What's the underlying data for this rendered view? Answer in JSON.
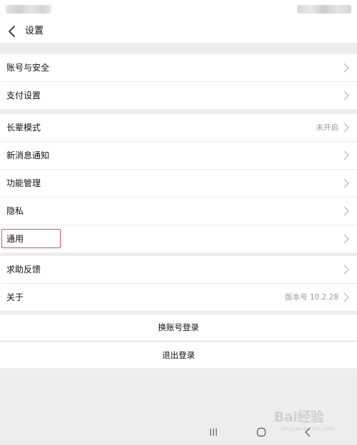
{
  "header": {
    "title": "设置"
  },
  "groups": [
    {
      "items": [
        {
          "label": "账号与安全",
          "value": ""
        },
        {
          "label": "支付设置",
          "value": ""
        }
      ]
    },
    {
      "items": [
        {
          "label": "长辈模式",
          "value": "未开启"
        },
        {
          "label": "新消息通知",
          "value": ""
        },
        {
          "label": "功能管理",
          "value": ""
        },
        {
          "label": "隐私",
          "value": ""
        },
        {
          "label": "通用",
          "value": ""
        }
      ]
    },
    {
      "items": [
        {
          "label": "求助反馈",
          "value": ""
        },
        {
          "label": "关于",
          "value": "版本号 10.2.28"
        }
      ]
    }
  ],
  "actions": {
    "switch_account": "换账号登录",
    "logout": "退出登录"
  },
  "annotation": {
    "highlighted_item": "通用",
    "color": "#e0504a"
  },
  "watermark": {
    "text": "Bai经验",
    "subtext": "jingyan.baidu.com"
  }
}
